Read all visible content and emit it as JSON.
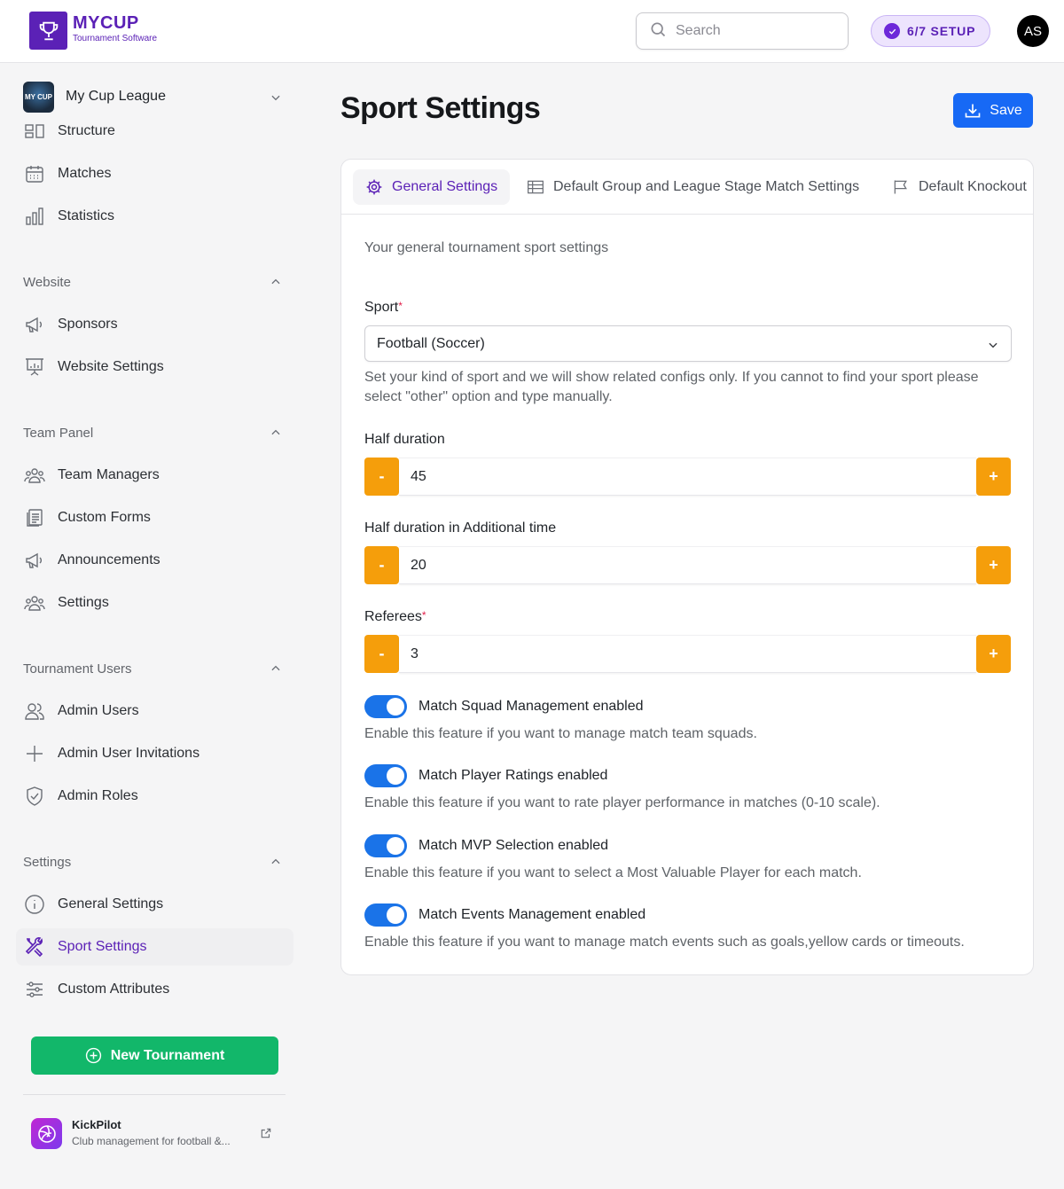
{
  "header": {
    "logo_title": "MYCUP",
    "logo_subtitle": "Tournament Software",
    "search_placeholder": "Search",
    "setup_badge": "6/7 SETUP",
    "avatar_initials": "AS"
  },
  "sidebar": {
    "league_name": "My Cup League",
    "league_logo_text": "MY CUP",
    "top_items": [
      {
        "label": "Structure",
        "icon": "structure-icon"
      },
      {
        "label": "Matches",
        "icon": "calendar-icon"
      },
      {
        "label": "Statistics",
        "icon": "bar-chart-icon"
      }
    ],
    "sections": [
      {
        "title": "Website",
        "items": [
          {
            "label": "Sponsors",
            "icon": "megaphone-icon"
          },
          {
            "label": "Website Settings",
            "icon": "presentation-icon"
          }
        ]
      },
      {
        "title": "Team Panel",
        "items": [
          {
            "label": "Team Managers",
            "icon": "users-group-icon"
          },
          {
            "label": "Custom Forms",
            "icon": "forms-icon"
          },
          {
            "label": "Announcements",
            "icon": "megaphone-icon"
          },
          {
            "label": "Settings",
            "icon": "users-group-icon"
          }
        ]
      },
      {
        "title": "Tournament Users",
        "items": [
          {
            "label": "Admin Users",
            "icon": "users-icon"
          },
          {
            "label": "Admin User Invitations",
            "icon": "plus-icon"
          },
          {
            "label": "Admin Roles",
            "icon": "shield-check-icon"
          }
        ]
      },
      {
        "title": "Settings",
        "items": [
          {
            "label": "General Settings",
            "icon": "info-icon"
          },
          {
            "label": "Sport Settings",
            "icon": "tools-icon",
            "active": true
          },
          {
            "label": "Custom Attributes",
            "icon": "sliders-icon"
          }
        ]
      }
    ],
    "new_tournament": "New Tournament",
    "kickpilot": {
      "name": "KickPilot",
      "description": "Club management for football &..."
    }
  },
  "main": {
    "title": "Sport Settings",
    "save_label": "Save",
    "tabs": [
      {
        "label": "General Settings",
        "icon": "gear-icon",
        "active": true
      },
      {
        "label": "Default Group and League Stage Match Settings",
        "icon": "table-icon"
      },
      {
        "label": "Default Knockout",
        "icon": "flag-icon"
      }
    ],
    "description": "Your general tournament sport settings",
    "sport": {
      "label": "Sport",
      "required_mark": "*",
      "value": "Football (Soccer)",
      "help": "Set your kind of sport and we will show related configs only. If you cannot to find your sport please select \"other\" option and type manually."
    },
    "half_duration": {
      "label": "Half duration",
      "value": "45",
      "minus": "-",
      "plus": "+"
    },
    "additional_time": {
      "label": "Half duration in Additional time",
      "value": "20",
      "minus": "-",
      "plus": "+"
    },
    "referees": {
      "label": "Referees",
      "required_mark": "*",
      "value": "3",
      "minus": "-",
      "plus": "+"
    },
    "toggles": [
      {
        "label": "Match Squad Management enabled",
        "help": "Enable this feature if you want to manage match team squads.",
        "on": true
      },
      {
        "label": "Match Player Ratings enabled",
        "help": "Enable this feature if you want to rate player performance in matches (0-10 scale).",
        "on": true
      },
      {
        "label": "Match MVP Selection enabled",
        "help": "Enable this feature if you want to select a Most Valuable Player for each match.",
        "on": true
      },
      {
        "label": "Match Events Management enabled",
        "help": "Enable this feature if you want to manage match events such as goals,yellow cards or timeouts.",
        "on": true
      }
    ]
  },
  "colors": {
    "brand": "#5b21b6",
    "primary_button": "#1769f5",
    "stepper": "#f59e0b",
    "toggle_on": "#1a73e8",
    "new_tournament": "#12b76a"
  }
}
